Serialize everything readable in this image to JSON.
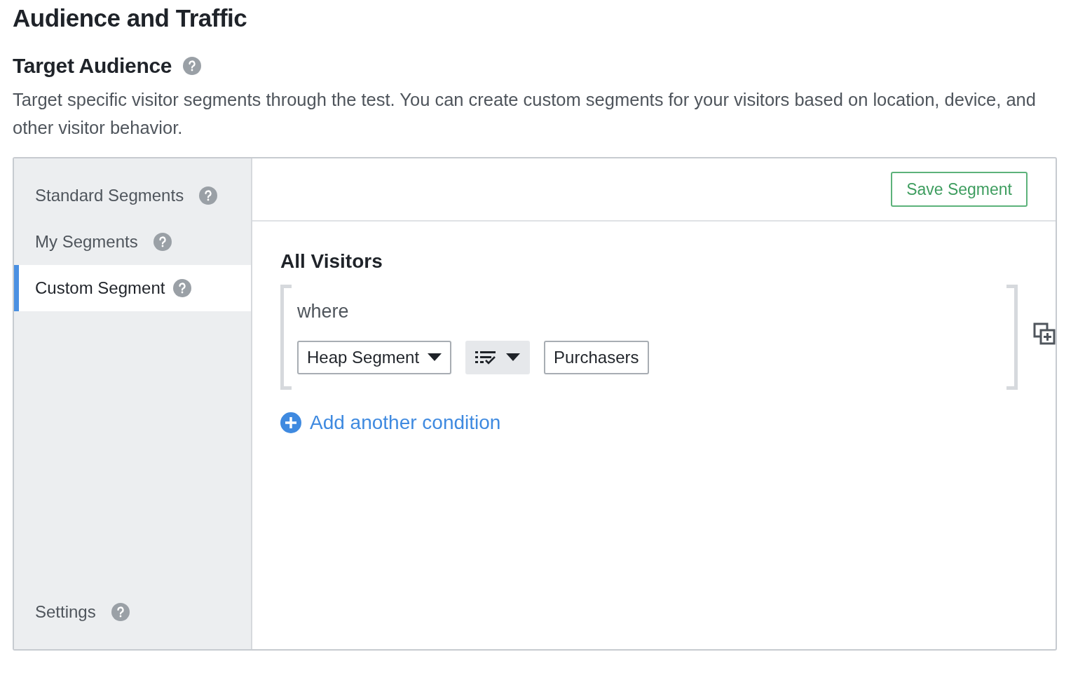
{
  "page_title": "Audience and Traffic",
  "section": {
    "title": "Target Audience",
    "description": "Target specific visitor segments through the test. You can create custom segments for your visitors based on location, device, and other visitor behavior."
  },
  "sidebar": {
    "items": [
      {
        "label": "Standard Segments",
        "selected": false
      },
      {
        "label": "My Segments",
        "selected": false
      },
      {
        "label": "Custom Segment",
        "selected": true
      }
    ],
    "footer_item": {
      "label": "Settings"
    }
  },
  "toolbar": {
    "save_button": "Save Segment"
  },
  "group": {
    "title": "All Visitors",
    "where_label": "where",
    "conditions": [
      {
        "field": "Heap Segment",
        "value": "Purchasers"
      }
    ]
  },
  "add_condition": "Add another condition"
}
